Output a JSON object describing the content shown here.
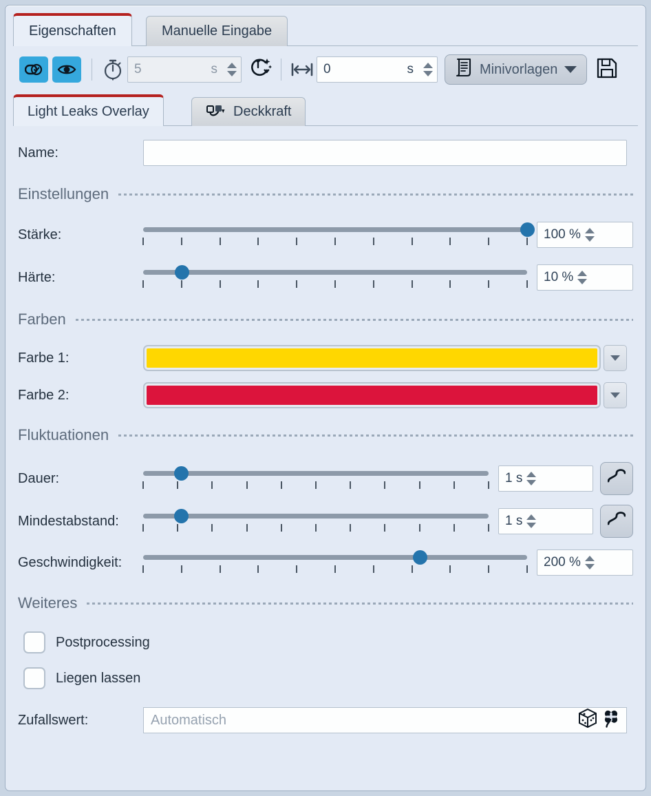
{
  "window": {
    "background_color": "#e3eaf5",
    "accent_red": "#b5211f",
    "accent_blue": "#35a8dd",
    "slider_knob_color": "#2474ac"
  },
  "top_tabs": [
    {
      "label": "Eigenschaften",
      "active": true
    },
    {
      "label": "Manuelle Eingabe",
      "active": false
    }
  ],
  "toolbar": {
    "toggle_button_icon": "toggle-check-icon",
    "visibility_button_icon": "eye-icon",
    "duration_icon": "stopwatch-icon",
    "duration_value": "5",
    "duration_unit": "s",
    "auto_timing_icon": "clock-sparkle-icon",
    "offset_icon": "span-arrows-icon",
    "offset_value": "0",
    "offset_unit": "s",
    "templates_icon": "template-document-icon",
    "templates_label": "Minivorlagen",
    "templates_caret": "chevron-down-icon",
    "save_icon": "floppy-save-icon"
  },
  "inner_tabs": [
    {
      "label": "Light Leaks Overlay",
      "active": true,
      "icon": ""
    },
    {
      "label": "Deckkraft",
      "active": false,
      "icon": "opacity-curve-icon"
    }
  ],
  "form": {
    "name_label": "Name:",
    "name_value": "",
    "name_placeholder": ""
  },
  "sections": {
    "settings": {
      "title": "Einstellungen",
      "rows": [
        {
          "label": "Stärke:",
          "value": "100 %",
          "percent": 100,
          "ticks": 11
        },
        {
          "label": "Härte:",
          "value": "10 %",
          "percent": 10,
          "ticks": 11
        }
      ]
    },
    "colors": {
      "title": "Farben",
      "rows": [
        {
          "label": "Farbe 1:",
          "color": "#ffd700"
        },
        {
          "label": "Farbe 2:",
          "color": "#dc143c"
        }
      ]
    },
    "fluctuations": {
      "title": "Fluktuationen",
      "rows": [
        {
          "label": "Dauer:",
          "value": "1 s",
          "percent": 11,
          "ticks": 11,
          "wave_button": true,
          "wave_icon": "sine-wave-icon"
        },
        {
          "label": "Mindestabstand:",
          "value": "1 s",
          "percent": 11,
          "ticks": 11,
          "wave_button": true,
          "wave_icon": "sine-wave-icon"
        },
        {
          "label": "Geschwindigkeit:",
          "value": "200 %",
          "percent": 72,
          "ticks": 11,
          "wave_button": false,
          "wave_icon": ""
        }
      ]
    },
    "other": {
      "title": "Weiteres",
      "checkboxes": [
        {
          "label": "Postprocessing",
          "checked": false
        },
        {
          "label": "Liegen lassen",
          "checked": false
        }
      ],
      "random": {
        "label": "Zufallswert:",
        "placeholder": "Automatisch",
        "value": "",
        "dice_icon": "dice-icon",
        "clover_icon": "four-leaf-clover-icon"
      }
    }
  }
}
